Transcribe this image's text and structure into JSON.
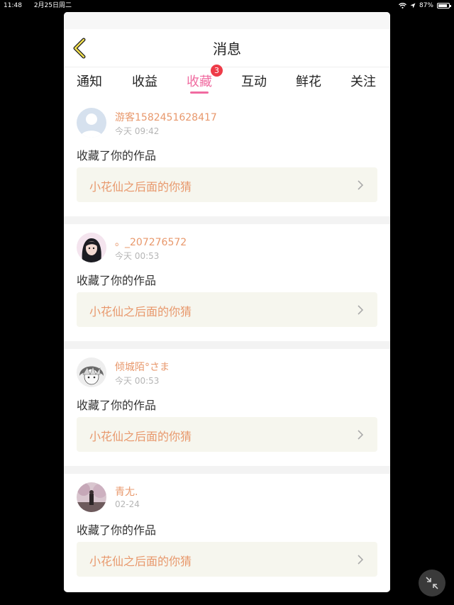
{
  "status_bar": {
    "time": "11:48",
    "date": "2月25日周二",
    "battery": "87%",
    "battery_level": 0.87
  },
  "header": {
    "title": "消息",
    "back_icon": "chevron-left-icon"
  },
  "tabs": [
    {
      "label": "通知"
    },
    {
      "label": "收益"
    },
    {
      "label": "收藏",
      "active": true,
      "badge": "3"
    },
    {
      "label": "互动"
    },
    {
      "label": "鲜花"
    },
    {
      "label": "关注"
    }
  ],
  "notifications": [
    {
      "username": "游客1582451628417",
      "time": "今天 09:42",
      "action": "收藏了你的作品",
      "work_title": "小花仙之后面的你猜",
      "avatar": "default-avatar"
    },
    {
      "username": "。_207276572",
      "time": "今天 00:53",
      "action": "收藏了你的作品",
      "work_title": "小花仙之后面的你猜",
      "avatar": "girl-avatar"
    },
    {
      "username": "倾城陌°さま",
      "time": "今天 00:53",
      "action": "收藏了你的作品",
      "work_title": "小花仙之后面的你猜",
      "avatar": "anime-avatar"
    },
    {
      "username": "青尢.",
      "time": "02-24",
      "action": "收藏了你的作品",
      "work_title": "小花仙之后面的你猜",
      "avatar": "photo-avatar"
    }
  ],
  "floating_button": {
    "icon": "collapse-arrows-icon"
  },
  "colors": {
    "accent": "#f06ba0",
    "username": "#e8986c",
    "badge": "#ee3b48"
  }
}
